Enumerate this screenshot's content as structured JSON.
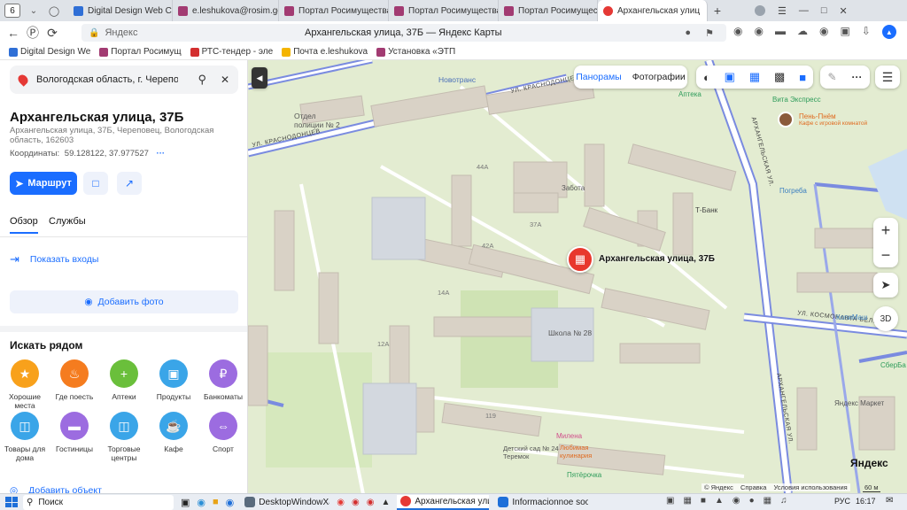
{
  "browser": {
    "tab_count": "6",
    "tabs": [
      {
        "label": "Digital Design Web Clie",
        "color": "#2f6fd6"
      },
      {
        "label": "e.leshukova@rosim.gov",
        "color": "#a23b72"
      },
      {
        "label": "Портал Росимущества",
        "color": "#a23b72"
      },
      {
        "label": "Портал Росимущества",
        "color": "#a23b72"
      },
      {
        "label": "Портал Росимущества",
        "color": "#a23b72"
      },
      {
        "label": "Архангельская улиц",
        "color": "#e53935"
      }
    ],
    "new_tab": "+",
    "address": {
      "site": "Яндекс",
      "title": "Архангельская улица, 37Б — Яндекс Карты"
    },
    "bookmarks": [
      {
        "label": "Digital Design We",
        "color": "#2f6fd6"
      },
      {
        "label": "Портал Росимущ",
        "color": "#a23b72"
      },
      {
        "label": "РТС-тендер - эле",
        "color": "#d32f2f"
      },
      {
        "label": "Почта e.leshukova",
        "color": "#f4b400"
      },
      {
        "label": "Установка «ЭТП",
        "color": "#a23b72"
      }
    ]
  },
  "panel": {
    "search_value": "Вологодская область, г. Череповец, у",
    "title": "Архангельская улица, 37Б",
    "address_line1": "Архангельская улица, 37Б, Череповец, Вологодская",
    "address_line2": "область, 162603",
    "coords_label": "Координаты:",
    "coords_value": "59.128122, 37.977527",
    "route_button": "Маршрут",
    "tabs": [
      "Обзор",
      "Службы"
    ],
    "show_entrances": "Показать входы",
    "add_photo": "Добавить фото",
    "nearby_title": "Искать рядом",
    "categories": [
      {
        "label": "Хорошие места",
        "color": "#f8a11b",
        "icon": "★"
      },
      {
        "label": "Где поесть",
        "color": "#f57c1f",
        "icon": "☕"
      },
      {
        "label": "Аптеки",
        "color": "#6abf3b",
        "icon": "+"
      },
      {
        "label": "Продукты",
        "color": "#3aa5e8",
        "icon": "▣"
      },
      {
        "label": "Банкоматы",
        "color": "#9c6ce0",
        "icon": "₽"
      },
      {
        "label": "Товары для дома",
        "color": "#3aa5e8",
        "icon": "⌂"
      },
      {
        "label": "Гостиницы",
        "color": "#9c6ce0",
        "icon": "≡"
      },
      {
        "label": "Торговые центры",
        "color": "#3aa5e8",
        "icon": "▤"
      },
      {
        "label": "Кафе",
        "color": "#f57c1f",
        "icon": "☕"
      },
      {
        "label": "Спорт",
        "color": "#9c6ce0",
        "icon": "↔"
      }
    ],
    "add_object": "Добавить объект"
  },
  "map": {
    "layer_buttons": [
      "Панорамы",
      "Фотографии"
    ],
    "marker_label": "Архангельская улица, 37Б",
    "labels": {
      "novotrans": "Новотранс",
      "street_krasnodoncev_1": "УЛ. КРАСНОДОНЦЕВ",
      "street_krasnodoncev_2": "УЛ. КРАСНОДОНЦЕВ",
      "street_arkh_1": "АРХАНГЕЛЬСКАЯ УЛ.",
      "street_arkh_2": "АРХАНГЕЛЬСКАЯ УЛ.",
      "street_kosmonavta": "УЛ. КОСМОНАВТА БЕЛЯЕВА",
      "otdel_police": "Отдел полиции № 2",
      "apteka": "Аптека",
      "vita": "Вита Экспресс",
      "pen": "Пень-Пнём",
      "pen_sub": "Кафе с игровой комнатой",
      "zabota": "Забота",
      "pogreba": "Погреба",
      "tbank": "Т-Банк",
      "kopimash": "КопиМаш",
      "sberbank": "СберБа",
      "school": "Школа № 28",
      "yandex_market": "Яндекс Маркет",
      "milena": "Милена",
      "lyubimaya": "Любимая кулинария",
      "detsad": "Детский сад № 24 Теремок",
      "pyaterochka": "Пятёрочка",
      "h44a": "44А",
      "h42a": "42А",
      "h37a": "37А",
      "h14a": "14А",
      "h12a": "12А",
      "h119": "119"
    },
    "zoom_in": "+",
    "zoom_out": "−",
    "btn_3d": "3D",
    "footer_copyright": "© Яндекс",
    "footer_help": "Справка",
    "footer_terms": "Условия использования",
    "scale": "60 м",
    "logo": "Яндекс"
  },
  "taskbar": {
    "search": "Поиск",
    "apps": [
      {
        "label": "DesktopWindowXaml...",
        "color": "#5a6b7d"
      },
      {
        "label": "Архангельская ули...",
        "color": "#e53935"
      },
      {
        "label": "Informacionnoe soob...",
        "color": "#1e6fd9"
      }
    ],
    "lang": "РУС",
    "time": "16:17"
  }
}
